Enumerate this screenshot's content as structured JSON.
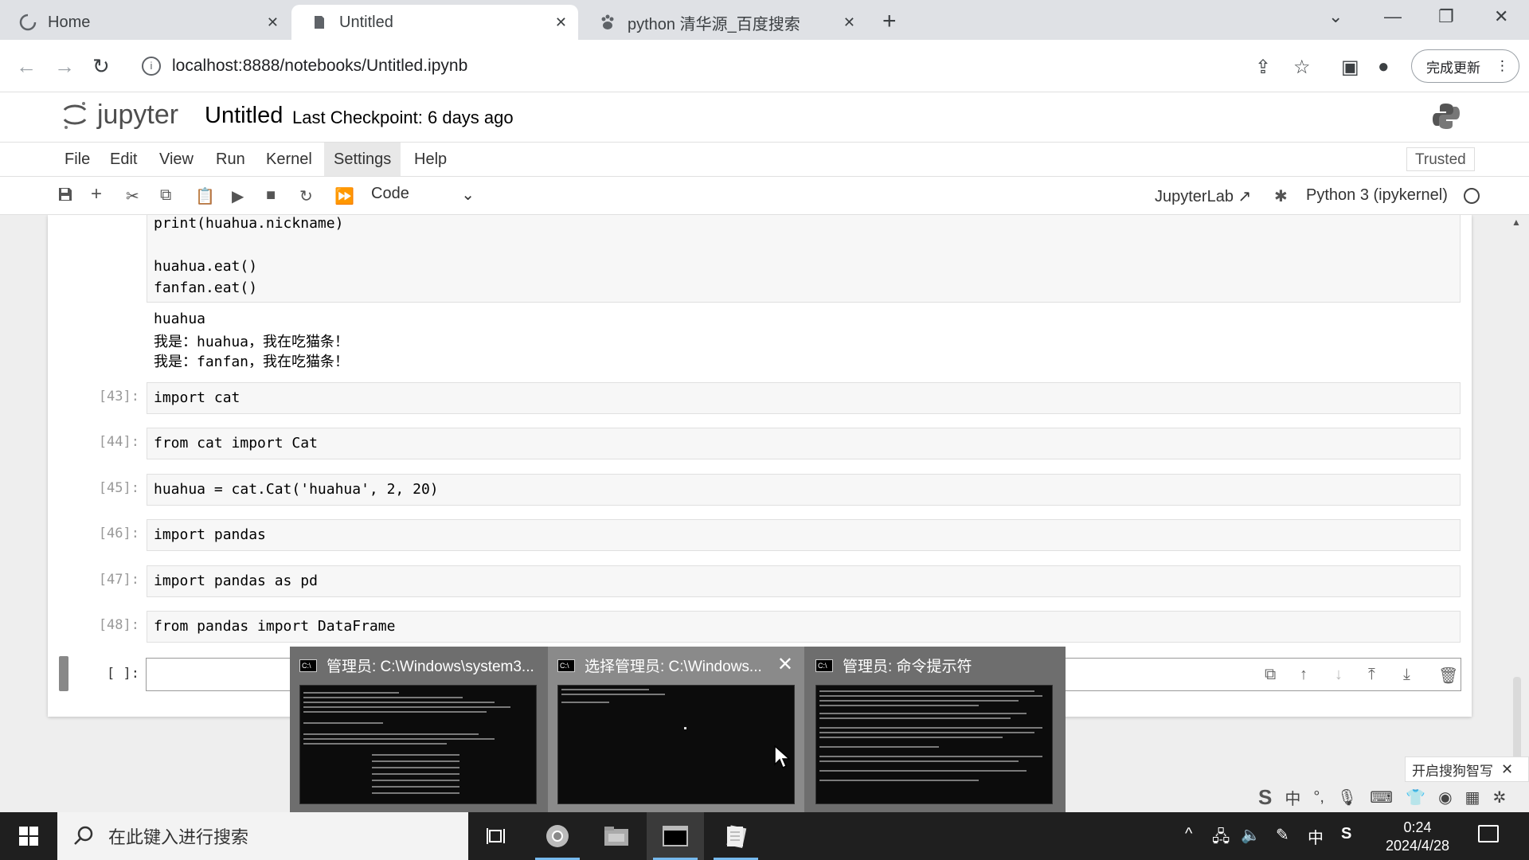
{
  "browser": {
    "tabs": [
      {
        "title": "Home",
        "icon": "loading-spinner-icon",
        "active": false
      },
      {
        "title": "Untitled",
        "icon": "jupyter-notebook-icon",
        "active": true
      },
      {
        "title": "python 清华源_百度搜索",
        "icon": "baidu-paw-icon",
        "active": false
      }
    ],
    "url": "localhost:8888/notebooks/Untitled.ipynb",
    "update_button": "完成更新"
  },
  "jupyter": {
    "logo_text": "jupyter",
    "notebook_title": "Untitled",
    "checkpoint": "Last Checkpoint: 6 days ago",
    "menu": [
      "File",
      "Edit",
      "View",
      "Run",
      "Kernel",
      "Settings",
      "Help"
    ],
    "trusted": "Trusted",
    "cell_type": "Code",
    "jupyterlab_link": "JupyterLab",
    "kernel_name": "Python 3 (ipykernel)"
  },
  "cells": {
    "top_code": [
      "print(huahua.nickname)",
      "",
      "huahua.eat()",
      "fanfan.eat()"
    ],
    "top_output": [
      "huahua",
      "我是：huahua，我在吃猫条！",
      "我是：fanfan，我在吃猫条！"
    ],
    "list": [
      {
        "prompt": "[43]:",
        "code": "import cat"
      },
      {
        "prompt": "[44]:",
        "code": "from cat import Cat"
      },
      {
        "prompt": "[45]:",
        "code": "huahua = cat.Cat('huahua', 2, 20)"
      },
      {
        "prompt": "[46]:",
        "code": "import pandas"
      },
      {
        "prompt": "[47]:",
        "code": "import pandas as pd"
      },
      {
        "prompt": "[48]:",
        "code": "from pandas import DataFrame"
      }
    ],
    "active_prompt": "[ ]:"
  },
  "taskbar_preview": [
    {
      "title": "管理员: C:\\Windows\\system3...",
      "hover": false
    },
    {
      "title": "选择管理员: C:\\Windows...",
      "hover": true
    },
    {
      "title": "管理员: 命令提示符",
      "hover": false
    }
  ],
  "ime": {
    "popup_text": "开启搜狗智写",
    "mode": "中"
  },
  "taskbar": {
    "search_placeholder": "在此键入进行搜索",
    "ime_indicator": "中",
    "time": "0:24",
    "date": "2024/4/28"
  }
}
